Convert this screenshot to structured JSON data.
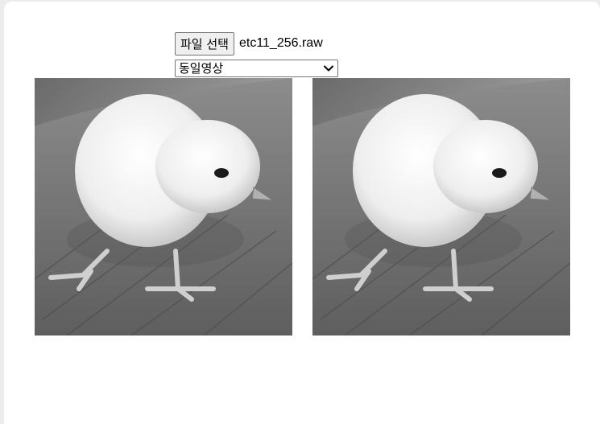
{
  "file_input": {
    "button_label": "파일 선택",
    "selected_file": "etc11_256.raw"
  },
  "mode_select": {
    "selected": "동일영상"
  },
  "images": {
    "left": {
      "icon": "chick-photo-grayscale"
    },
    "right": {
      "icon": "chick-photo-grayscale"
    }
  }
}
